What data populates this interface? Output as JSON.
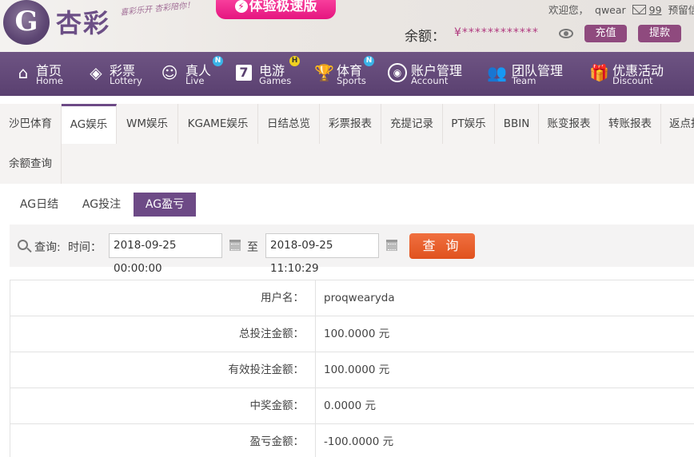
{
  "header": {
    "logo_glyph": "G",
    "logo_text": "杏彩",
    "slogan": "喜彩乐开 杏彩陪你！",
    "promo_label": "体验极速版",
    "welcome": "欢迎您，",
    "username": "qwear",
    "message_count": "99",
    "extra_link": "预留信",
    "balance_label": "余额：",
    "balance_value": "¥************",
    "recharge_label": "充值",
    "withdraw_label": "提款"
  },
  "nav": [
    {
      "cn": "首页",
      "en": "Home",
      "icon": "home-icon"
    },
    {
      "cn": "彩票",
      "en": "Lottery",
      "icon": "lottery-icon"
    },
    {
      "cn": "真人",
      "en": "Live",
      "icon": "live-icon",
      "badge": "N"
    },
    {
      "cn": "电游",
      "en": "Games",
      "icon": "games-icon",
      "badge": "H"
    },
    {
      "cn": "体育",
      "en": "Sports",
      "icon": "trophy-icon",
      "badge": "N"
    },
    {
      "cn": "账户管理",
      "en": "Account",
      "icon": "account-icon"
    },
    {
      "cn": "团队管理",
      "en": "Team",
      "icon": "team-icon"
    },
    {
      "cn": "优惠活动",
      "en": "Discount",
      "icon": "gift-icon"
    }
  ],
  "tabs": [
    "沙巴体育",
    "AG娱乐",
    "WM娱乐",
    "KGAME娱乐",
    "日结总览",
    "彩票报表",
    "充提记录",
    "PT娱乐",
    "BBIN",
    "账变报表",
    "转账报表",
    "返点报表",
    "余额查询"
  ],
  "active_tab": "AG娱乐",
  "subtabs": [
    "AG日结",
    "AG投注",
    "AG盈亏"
  ],
  "active_subtab": "AG盈亏",
  "query": {
    "label": "查询:",
    "time_label": "时间：",
    "start": "2018-09-25 00:00:00",
    "to_label": "至",
    "end": "2018-09-25 11:10:29",
    "button": "查 询"
  },
  "result": [
    {
      "label": "用户名：",
      "value": "proqwearyda"
    },
    {
      "label": "总投注金额：",
      "value": "100.0000 元"
    },
    {
      "label": "有效投注金额：",
      "value": "100.0000 元"
    },
    {
      "label": "中奖金额：",
      "value": "0.0000 元"
    },
    {
      "label": "盈亏金额：",
      "value": "-100.0000 元"
    }
  ]
}
